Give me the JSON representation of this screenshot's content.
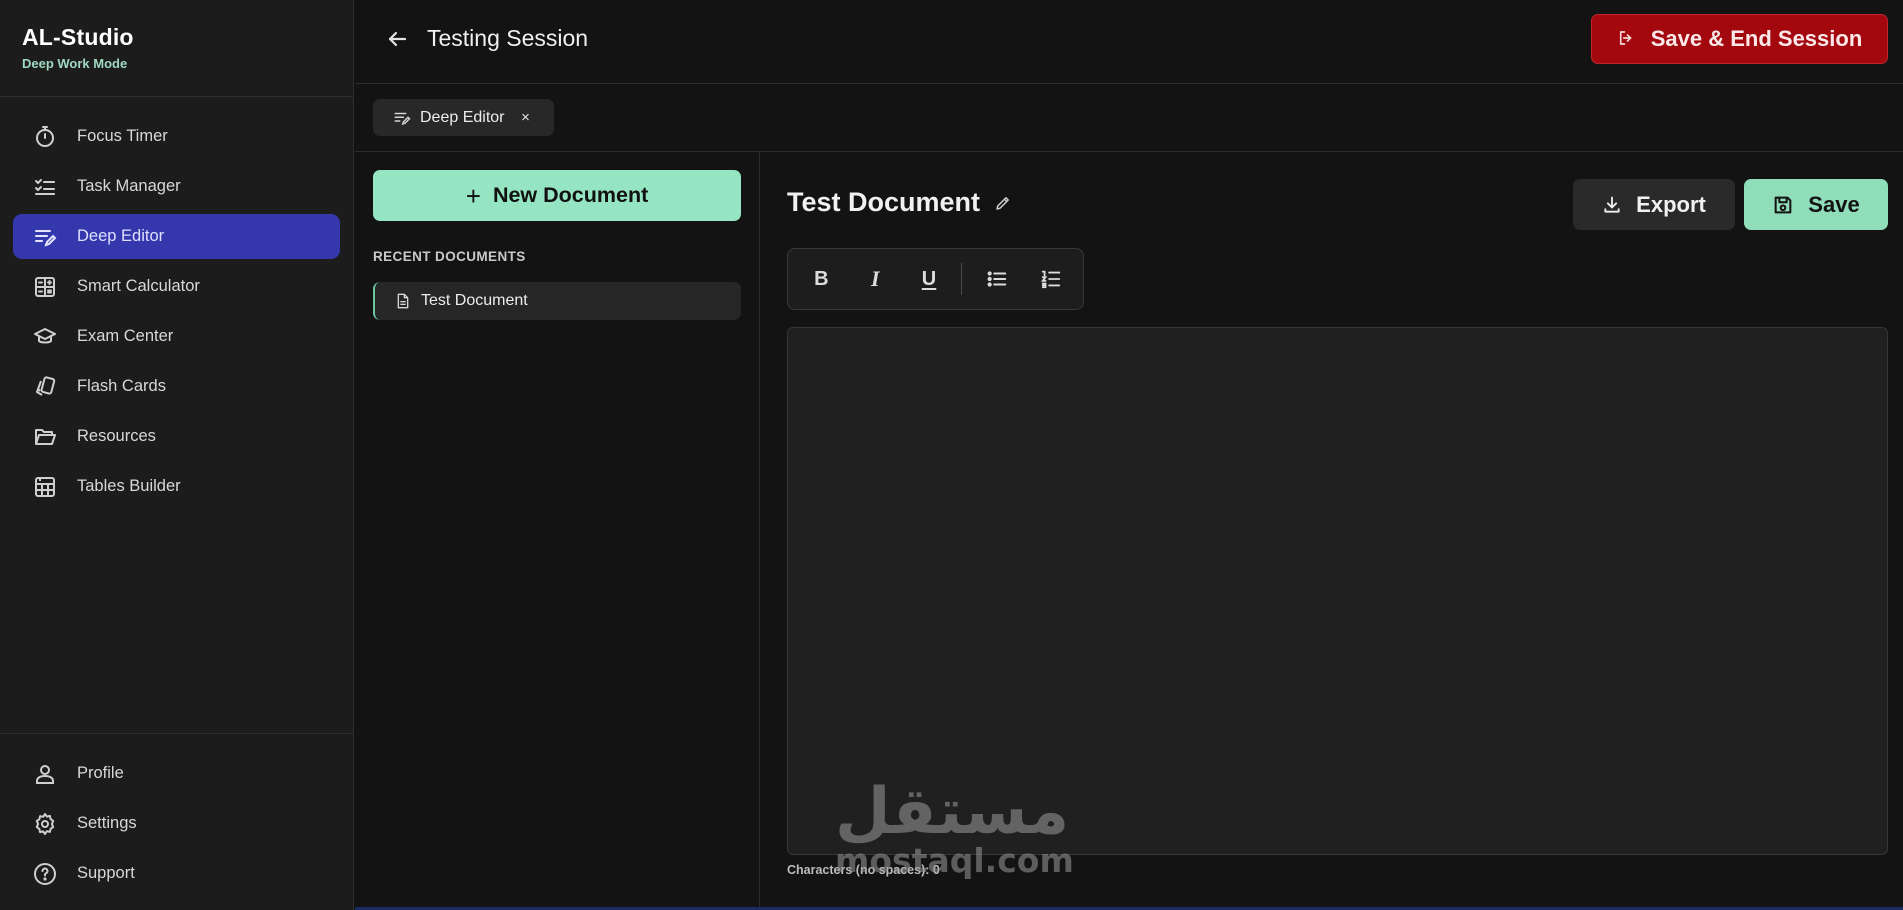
{
  "brand": {
    "title": "AL-Studio",
    "subtitle": "Deep Work Mode"
  },
  "sidebar": {
    "items": [
      {
        "label": "Focus Timer",
        "icon": "stopwatch-icon",
        "active": false
      },
      {
        "label": "Task Manager",
        "icon": "checklist-icon",
        "active": false
      },
      {
        "label": "Deep Editor",
        "icon": "edit-lines-icon",
        "active": true
      },
      {
        "label": "Smart Calculator",
        "icon": "calculator-icon",
        "active": false
      },
      {
        "label": "Exam Center",
        "icon": "graduation-cap-icon",
        "active": false
      },
      {
        "label": "Flash Cards",
        "icon": "cards-icon",
        "active": false
      },
      {
        "label": "Resources",
        "icon": "folder-open-icon",
        "active": false
      },
      {
        "label": "Tables Builder",
        "icon": "table-icon",
        "active": false
      }
    ],
    "bottom_items": [
      {
        "label": "Profile",
        "icon": "user-icon"
      },
      {
        "label": "Settings",
        "icon": "gear-icon"
      },
      {
        "label": "Support",
        "icon": "help-circle-icon"
      }
    ],
    "active_color": "#3538ad"
  },
  "header": {
    "title": "Testing Session",
    "end_session_label": "Save & End Session",
    "end_session_color": "#a4080f"
  },
  "tabs": [
    {
      "label": "Deep Editor",
      "icon": "edit-lines-icon",
      "close": "×"
    }
  ],
  "documents": {
    "new_label": "New Document",
    "new_icon": "+",
    "recent_heading": "RECENT DOCUMENTS",
    "recent": [
      {
        "label": "Test Document",
        "icon": "file-icon"
      }
    ],
    "accent_color": "#96e5c2"
  },
  "editor": {
    "doc_title": "Test Document",
    "export_label": "Export",
    "save_label": "Save",
    "toolbar": {
      "bold": "B",
      "italic": "I",
      "underline": "U"
    },
    "char_count": "Characters (no spaces): 0"
  },
  "watermark": {
    "arabic": "مستقل",
    "latin": "mostaql.com"
  }
}
